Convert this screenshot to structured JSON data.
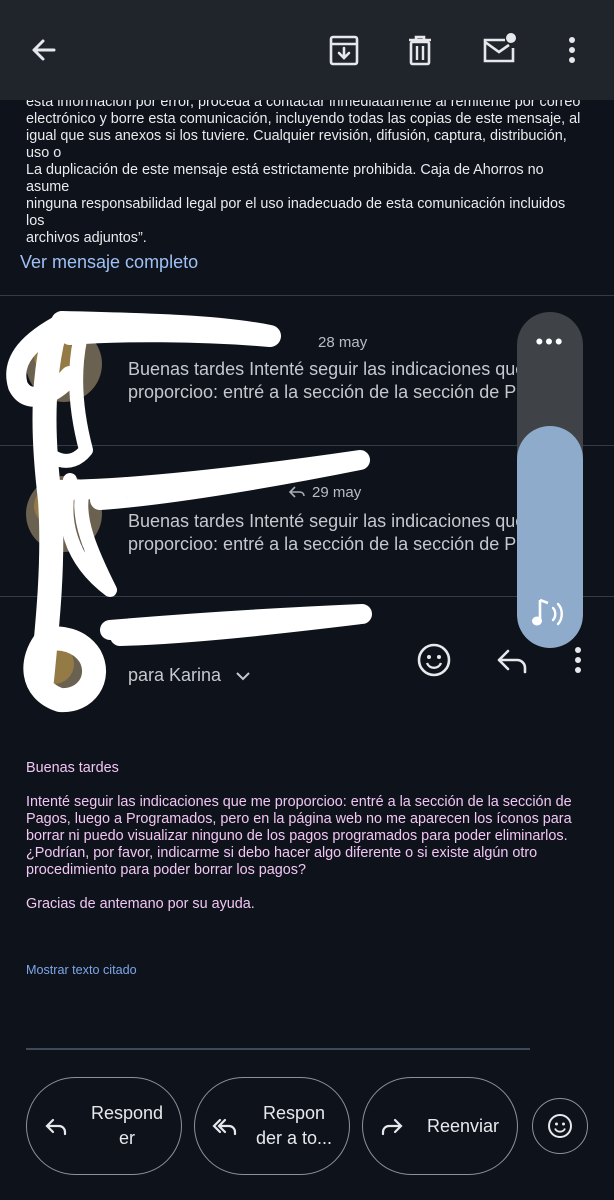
{
  "toolbar": {
    "back": "back-arrow-icon",
    "archive": "archive-icon",
    "delete": "delete-icon",
    "mark_unread": "mark-unread-icon",
    "more": "more-vert-icon"
  },
  "disclaimer": {
    "lines": [
      "esta información por error, proceda a contactar inmediatamente al remitente por correo",
      "electrónico y borre esta comunicación, incluyendo todas las copias de este mensaje, al",
      "igual que sus anexos si los tuviere. Cualquier revisión, difusión, captura, distribución, uso o",
      "La duplicación de este mensaje está estrictamente prohibida. Caja de Ahorros no asume",
      "ninguna responsabilidad legal por el uso inadecuado de esta comunicación incluidos los",
      "archivos adjuntos”."
    ]
  },
  "full_message_link": "Ver mensaje completo",
  "threads": [
    {
      "date": "28 may",
      "snippet_line1": "Buenas tardes Intenté seguir las indicaciones que me",
      "snippet_line2": "proporcioo: entré a la sección de la sección de Pagos"
    },
    {
      "date": "29 may",
      "snippet_line1": "Buenas tardes Intenté seguir las indicaciones que me",
      "snippet_line2": "proporcioo: entré a la sección de la sección de Pagos"
    }
  ],
  "current_message": {
    "to_label": "para Karina",
    "greeting": "Buenas tardes",
    "paragraph": "Intenté seguir las indicaciones que me proporcioo: entré a la sección de la sección de Pagos, luego a Programados, pero en la página web no me aparecen los íconos para borrar ni puedo visualizar ninguno de los pagos programados para poder eliminarlos. ¿Podrían, por favor, indicarme si debo hacer algo diferente o si existe algún otro procedimiento para poder borrar los pagos?",
    "thanks": "Gracias de antemano por su ayuda.",
    "show_quoted": "Mostrar texto citado"
  },
  "volume": {
    "level": 0.66,
    "menu_dots": "•••"
  },
  "actions": {
    "reply_line1": "Respond",
    "reply_line2": "er",
    "reply_all_line1": "Respon",
    "reply_all_line2": "der a to...",
    "forward": "Reenviar"
  },
  "colors": {
    "background": "#0e121a",
    "toolbar": "#20242b",
    "link": "#9fc0f5",
    "body_text": "#f1c6f4",
    "volume_fill": "#8eabcb"
  }
}
